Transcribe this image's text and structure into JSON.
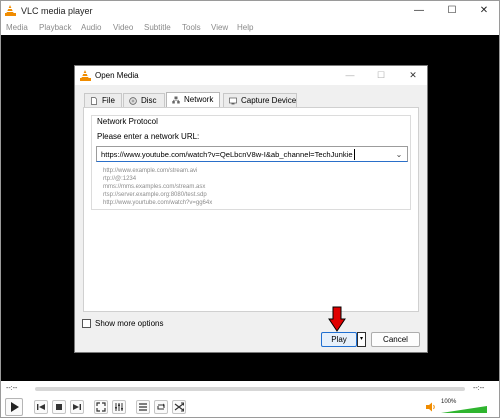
{
  "window": {
    "title": "VLC media player",
    "controls": [
      "—",
      "☐",
      "✕"
    ]
  },
  "menu": [
    "Media",
    "Playback",
    "Audio",
    "Video",
    "Subtitle",
    "Tools",
    "View",
    "Help"
  ],
  "dialog": {
    "title": "Open Media",
    "controls": [
      "—",
      "☐",
      "✕"
    ],
    "tabs": [
      {
        "label": "File",
        "icon": "file-icon"
      },
      {
        "label": "Disc",
        "icon": "disc-icon"
      },
      {
        "label": "Network",
        "icon": "network-icon"
      },
      {
        "label": "Capture Device",
        "icon": "capture-icon"
      }
    ],
    "active_tab": "Network",
    "group_label": "Network Protocol",
    "prompt": "Please enter a network URL:",
    "url_value": "https://www.youtube.com/watch?v=QeLbcnV8w-I&ab_channel=TechJunkie",
    "examples": [
      "http://www.example.com/stream.avi",
      "rtp://@:1234",
      "mms://mms.examples.com/stream.asx",
      "rtsp://server.example.org:8080/test.sdp",
      "http://www.yourtube.com/watch?v=gg64x"
    ],
    "show_more_options": "Show more options",
    "show_more_checked": false,
    "play_label": "Play",
    "play_dropdown": "▾",
    "cancel_label": "Cancel"
  },
  "player": {
    "time_elapsed": "--:--",
    "time_total": "--:--",
    "volume": "100%",
    "volume_level": 1.0,
    "accent": "#f08c00",
    "volume_color": "#2fb52f"
  }
}
